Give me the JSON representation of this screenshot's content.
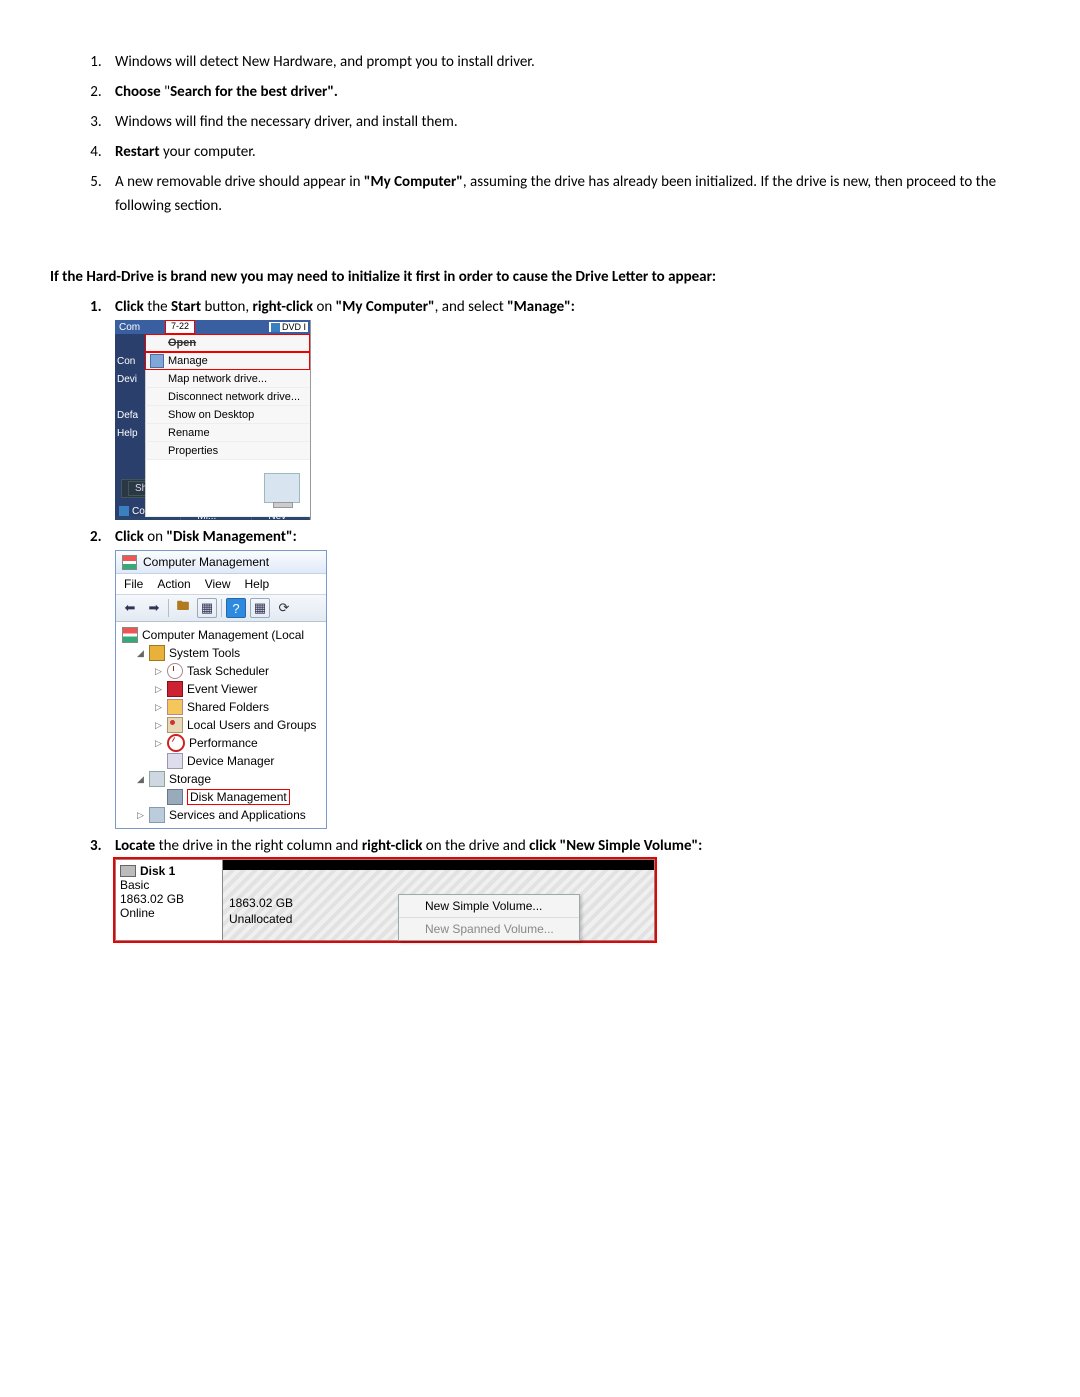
{
  "intro_list": {
    "i1": "Windows will detect New Hardware, and prompt you to install driver.",
    "i2a": "Choose",
    "i2b": " \"",
    "i2c": "Search for the best driver\".",
    "i3": "Windows will find the necessary driver, and install them.",
    "i4a": "Restart",
    "i4b": " your computer.",
    "i5a": "A new removable drive should appear in ",
    "i5b": "\"My Computer\"",
    "i5c": ", assuming the drive has already been initialized. If the drive is new, then proceed to the following section."
  },
  "heading": "If the Hard-Drive is brand new you may need to initialize it first in order to cause the Drive Letter to appear:",
  "steps": {
    "s1a": "Click",
    "s1b": " the ",
    "s1c": "Start",
    "s1d": " button, ",
    "s1e": "right-click",
    "s1f": " on ",
    "s1g": "\"My Computer\"",
    "s1h": ", and select ",
    "s1i": "\"Manage\":",
    "s2a": "Click",
    "s2b": " on ",
    "s2c": "\"Disk Management\":",
    "s3a": "Locate",
    "s3b": " the drive in the right column and ",
    "s3c": "right-click",
    "s3d": " on the drive and ",
    "s3e": "click \"New Simple Volume\":"
  },
  "shot1": {
    "top_com": "Com",
    "redbox": "7-22",
    "dvd": "DVD I",
    "side": {
      "con": "Con",
      "dev": "Devi",
      "def": "Defa",
      "help": "Help"
    },
    "menu": {
      "open": "Open",
      "manage": "Manage",
      "map": "Map network drive...",
      "disc": "Disconnect network drive...",
      "show": "Show on Desktop",
      "rename": "Rename",
      "props": "Properties"
    },
    "shutdown": "Shut down",
    "tb": {
      "comp": "Computer",
      "inbox": "Inbox - Mi...",
      "fw": "FW: Nev"
    }
  },
  "shot2": {
    "title": "Computer Management",
    "menus": {
      "file": "File",
      "action": "Action",
      "view": "View",
      "help": "Help"
    },
    "tree": {
      "root": "Computer Management (Local",
      "systools": "System Tools",
      "task": "Task Scheduler",
      "event": "Event Viewer",
      "shared": "Shared Folders",
      "users": "Local Users and Groups",
      "perf": "Performance",
      "devmgr": "Device Manager",
      "storage": "Storage",
      "diskmgmt": "Disk Management",
      "svc": "Services and Applications"
    }
  },
  "shot3": {
    "disk": "Disk 1",
    "type": "Basic",
    "size": "1863.02 GB",
    "status": "Online",
    "vol_size": "1863.02 GB",
    "vol_state": "Unallocated",
    "menu": {
      "nsv": "New Simple Volume...",
      "nspv": "New Spanned Volume..."
    }
  }
}
